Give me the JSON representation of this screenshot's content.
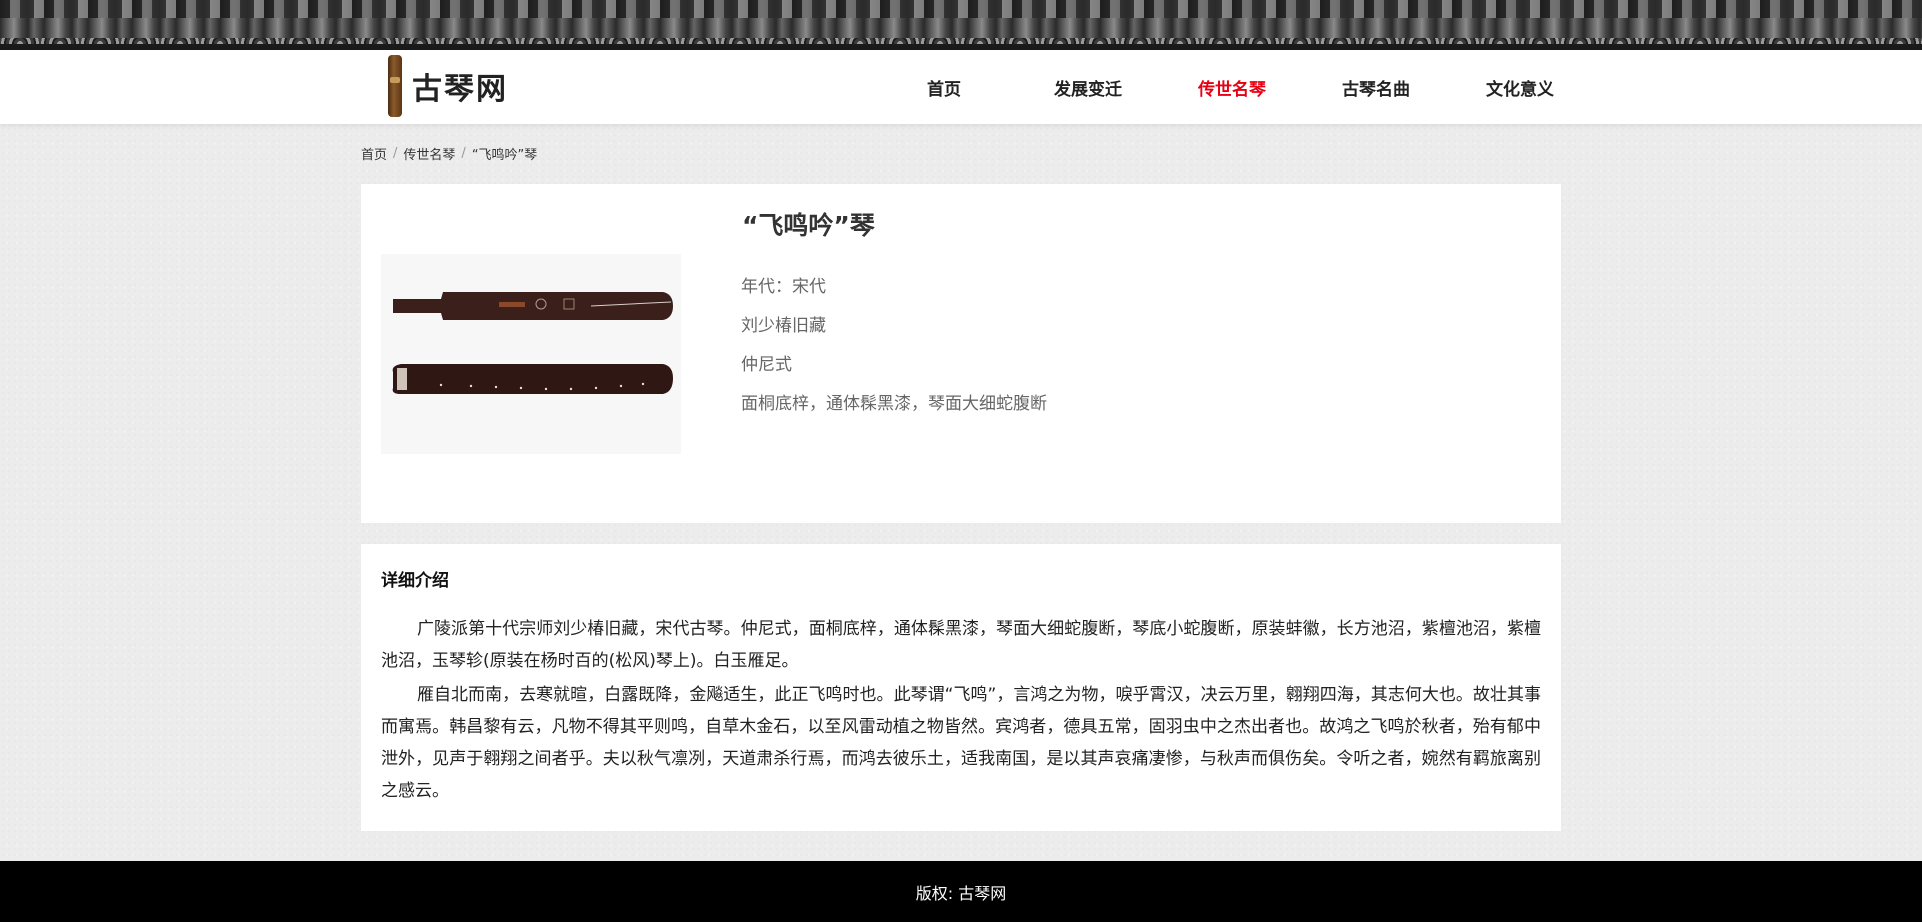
{
  "header": {
    "logo_text": "古琴网",
    "nav": [
      {
        "label": "首页"
      },
      {
        "label": "发展变迁"
      },
      {
        "label": "传世名琴"
      },
      {
        "label": "古琴名曲"
      },
      {
        "label": "文化意义"
      }
    ],
    "active_index": 2,
    "active_color": "#e60012"
  },
  "breadcrumb": {
    "items": [
      "首页",
      "传世名琴",
      "“飞鸣吟”琴"
    ],
    "separator": "/"
  },
  "instrument": {
    "title": "“飞鸣吟”琴",
    "era": "年代：宋代",
    "collection": "刘少椿旧藏",
    "style": "仲尼式",
    "material": "面桐底梓，通体髹黑漆，琴面大细蛇腹断"
  },
  "detail": {
    "heading": "详细介绍",
    "paragraphs": [
      "广陵派第十代宗师刘少椿旧藏，宋代古琴。仲尼式，面桐底梓，通体髹黑漆，琴面大细蛇腹断，琴底小蛇腹断，原装蚌徽，长方池沼，紫檀池沼，紫檀池沼，玉琴轸(原装在杨时百的(松风)琴上)。白玉雁足。",
      "雁自北而南，去寒就暄，白露既降，金飚适生，此正飞鸣时也。此琴谓“飞鸣”，言鸿之为物，唳乎霄汉，决云万里，翱翔四海，其志何大也。故壮其事而寓焉。韩昌黎有云，凡物不得其平则鸣，自草木金石，以至风雷动植之物皆然。宾鸿者，德具五常，固羽虫中之杰出者也。故鸿之飞鸣於秋者，殆有郁中泄外，见声于翱翔之间者乎。夫以秋气凛冽，天道肃杀行焉，而鸿去彼乐土，适我南国，是以其声哀痛凄惨，与秋声而俱伤矣。令听之者，婉然有羁旅离别之感云。"
    ]
  },
  "footer": {
    "copyright": "版权: 古琴网"
  }
}
